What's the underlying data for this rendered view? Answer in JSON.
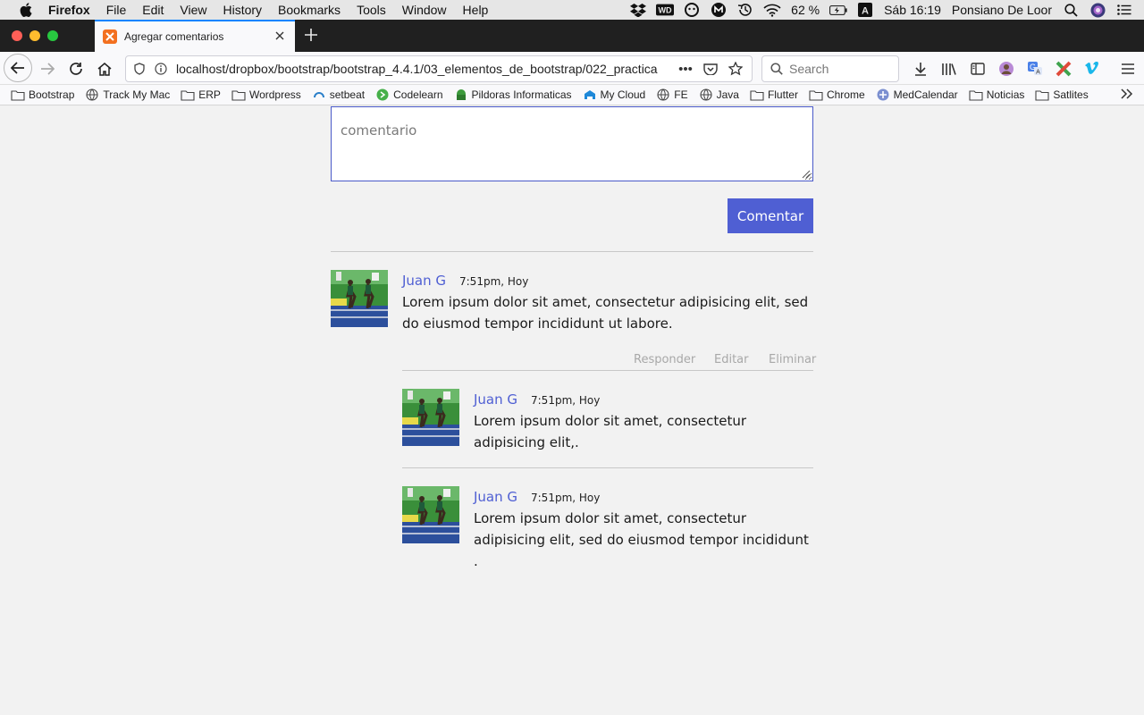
{
  "menubar": {
    "app_name": "Firefox",
    "menus": [
      "File",
      "Edit",
      "View",
      "History",
      "Bookmarks",
      "Tools",
      "Window",
      "Help"
    ],
    "battery": "62 %",
    "input_source": "A",
    "clock": "Sáb 16:19",
    "user": "Ponsiano De Loor"
  },
  "tab": {
    "title": "Agregar comentarios"
  },
  "urlbar": {
    "url": "localhost/dropbox/bootstrap/bootstrap_4.4.1/03_elementos_de_bootstrap/022_practica",
    "more": "•••"
  },
  "searchbar": {
    "placeholder": "Search"
  },
  "bookmarks": [
    {
      "label": "Bootstrap",
      "icon": "folder"
    },
    {
      "label": "Track My Mac",
      "icon": "globe"
    },
    {
      "label": "ERP",
      "icon": "folder"
    },
    {
      "label": "Wordpress",
      "icon": "folder"
    },
    {
      "label": "setbeat",
      "icon": "setbeat"
    },
    {
      "label": "Codelearn",
      "icon": "codelearn"
    },
    {
      "label": "Pildoras Informaticas",
      "icon": "pildoras"
    },
    {
      "label": "My Cloud",
      "icon": "cloud"
    },
    {
      "label": "FE",
      "icon": "globe"
    },
    {
      "label": "Java",
      "icon": "globe"
    },
    {
      "label": "Flutter",
      "icon": "folder"
    },
    {
      "label": "Chrome",
      "icon": "folder"
    },
    {
      "label": "MedCalendar",
      "icon": "medcalendar"
    },
    {
      "label": "Noticias",
      "icon": "folder"
    },
    {
      "label": "Satlites",
      "icon": "folder"
    }
  ],
  "form": {
    "placeholder": "comentario",
    "submit_label": "Comentar"
  },
  "comments": {
    "main": {
      "author": "Juan G",
      "time": "7:51pm, Hoy",
      "text": "Lorem ipsum dolor sit amet, consectetur adipisicing elit, sed do eiusmod tempor incididunt ut labore.",
      "actions": [
        "Responder",
        "Editar",
        "Eliminar"
      ]
    },
    "replies": [
      {
        "author": "Juan G",
        "time": "7:51pm, Hoy",
        "text": "Lorem ipsum dolor sit amet, consectetur adipisicing elit,."
      },
      {
        "author": "Juan G",
        "time": "7:51pm, Hoy",
        "text": "Lorem ipsum dolor sit amet, consectetur adipisicing elit, sed do eiusmod tempor incididunt ."
      }
    ]
  },
  "colors": {
    "accent": "#4f5fd3",
    "action_gray": "#a8a8a8",
    "page_bg": "#f2f2f2"
  }
}
